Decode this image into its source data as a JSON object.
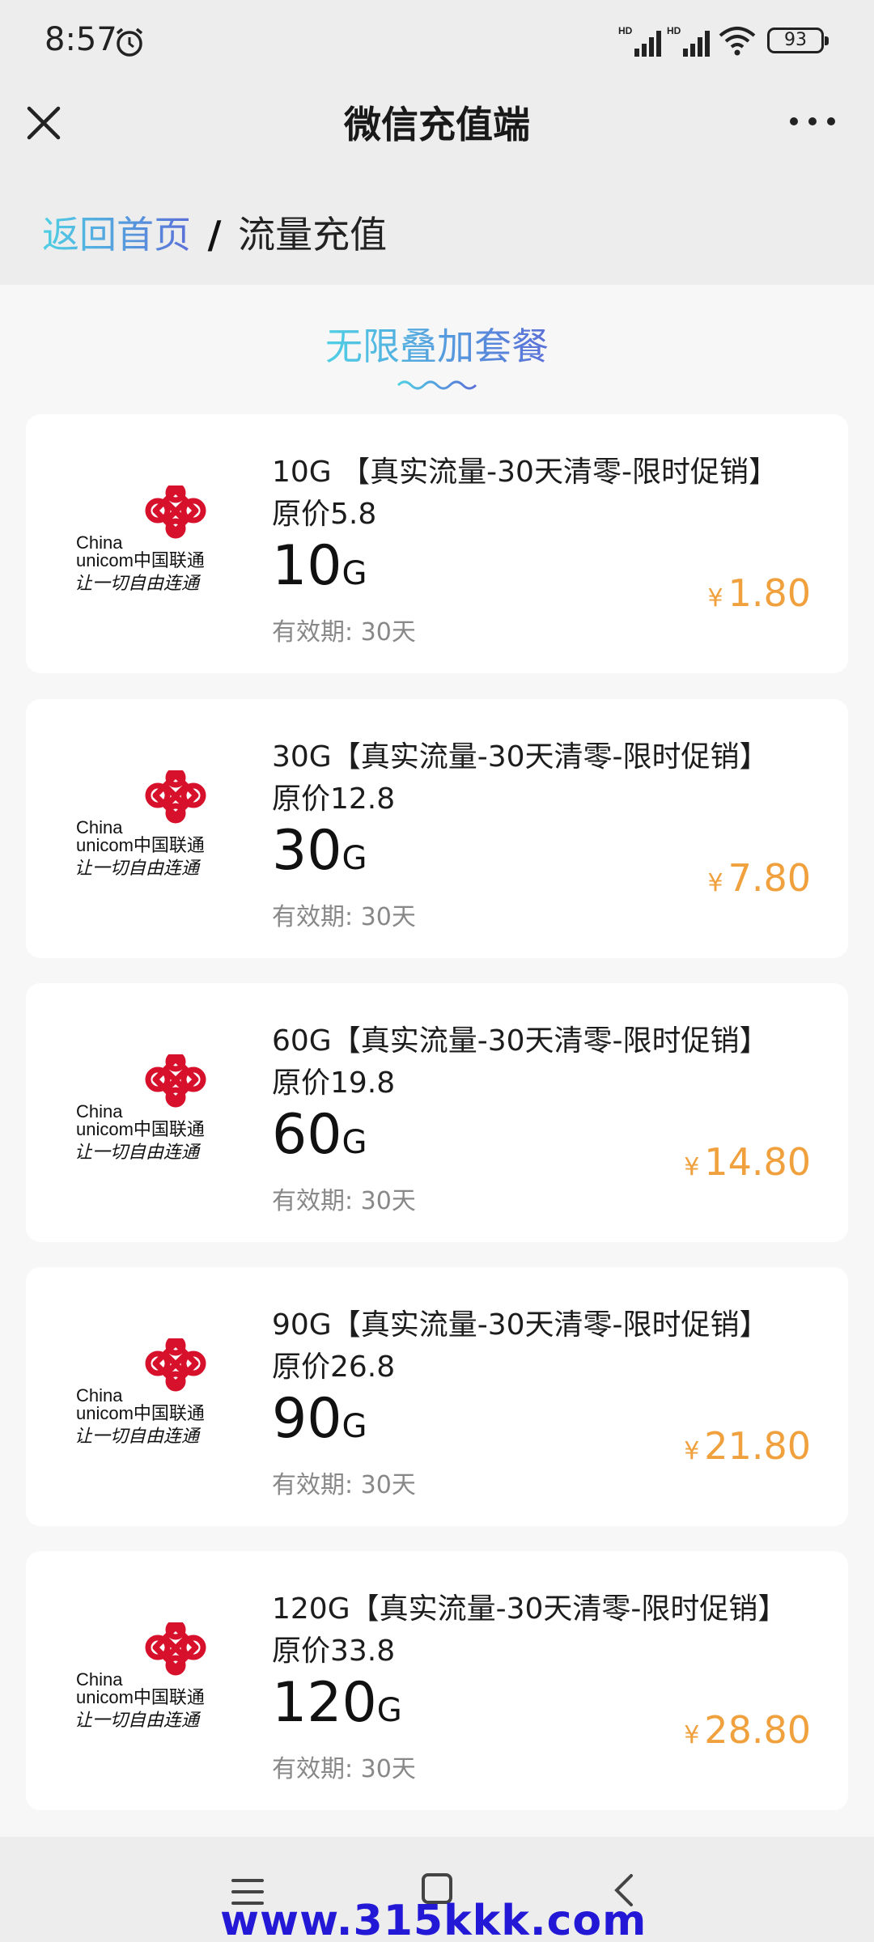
{
  "status_bar": {
    "time": "8:57",
    "battery": "93",
    "icons": [
      "alarm-icon",
      "hd-signal-icon",
      "hd-signal-icon",
      "wifi-icon",
      "battery-icon"
    ]
  },
  "title_bar": {
    "title": "微信充值端",
    "close_icon": "close-icon",
    "more_icon": "more-icon"
  },
  "breadcrumb": {
    "home": "返回首页",
    "separator": "/",
    "current": "流量充值"
  },
  "section": {
    "title": "无限叠加套餐"
  },
  "products": [
    {
      "name": "10G 【真实流量-30天清零-限时促销】",
      "original_price": "原价5.8",
      "size": "10",
      "unit": "G",
      "validity": "有效期: 30天",
      "currency": "¥",
      "price": "1.80"
    },
    {
      "name": "30G【真实流量-30天清零-限时促销】",
      "original_price": "原价12.8",
      "size": "30",
      "unit": "G",
      "validity": "有效期: 30天",
      "currency": "¥",
      "price": "7.80"
    },
    {
      "name": "60G【真实流量-30天清零-限时促销】",
      "original_price": "原价19.8",
      "size": "60",
      "unit": "G",
      "validity": "有效期: 30天",
      "currency": "¥",
      "price": "14.80"
    },
    {
      "name": "90G【真实流量-30天清零-限时促销】",
      "original_price": "原价26.8",
      "size": "90",
      "unit": "G",
      "validity": "有效期: 30天",
      "currency": "¥",
      "price": "21.80"
    },
    {
      "name": "120G【真实流量-30天清零-限时促销】",
      "original_price": "原价33.8",
      "size": "120",
      "unit": "G",
      "validity": "有效期: 30天",
      "currency": "¥",
      "price": "28.80"
    }
  ],
  "logo": {
    "line1": "China",
    "line2": "unicom中国联通",
    "slogan": "让一切自由连通"
  },
  "nav_bar": {
    "icons": [
      "menu-icon",
      "home-icon",
      "back-icon"
    ]
  },
  "watermark": "www.315kkk.com",
  "colors": {
    "accent_price": "#f0a03c",
    "gradient_start": "#4fd0e4",
    "gradient_end": "#5b6fd8",
    "unicom_red": "#d7102b"
  }
}
